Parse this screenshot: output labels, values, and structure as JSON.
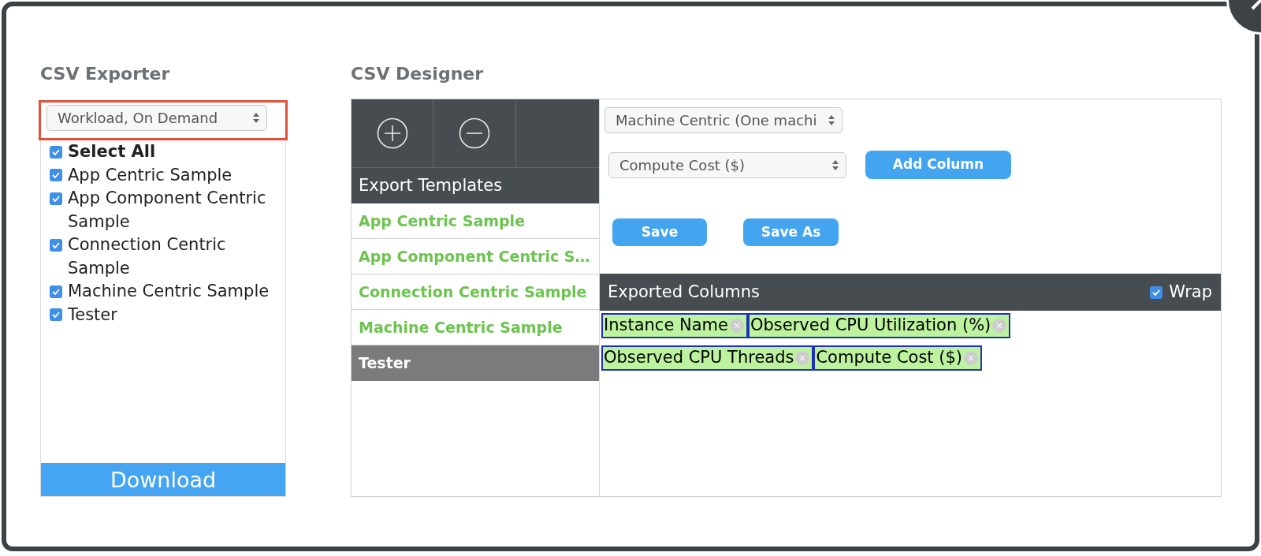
{
  "exporter": {
    "title": "CSV Exporter",
    "selector": {
      "value": "Workload, On Demand",
      "highlighted": true
    },
    "items": [
      {
        "label": "Select All",
        "kind": "all",
        "checked": true
      },
      {
        "label": "App Centric Sample",
        "kind": "template",
        "checked": true
      },
      {
        "label": "App Component Centric Sample",
        "kind": "template",
        "checked": true
      },
      {
        "label": "Connection Centric Sample",
        "kind": "template",
        "checked": true
      },
      {
        "label": "Machine Centric Sample",
        "kind": "template",
        "checked": true
      },
      {
        "label": "Tester",
        "kind": "template",
        "checked": true
      }
    ],
    "download": "Download"
  },
  "designer": {
    "title": "CSV Designer",
    "templates_header": "Export Templates",
    "templates": [
      {
        "label": "App Centric Sample",
        "selected": false
      },
      {
        "label": "App Component Centric S…",
        "selected": false
      },
      {
        "label": "Connection Centric Sample",
        "selected": false
      },
      {
        "label": "Machine Centric Sample",
        "selected": false
      },
      {
        "label": "Tester",
        "selected": true
      }
    ],
    "view_selector": {
      "value": "Machine Centric (One machi"
    },
    "column_selector": {
      "value": "Compute Cost ($)"
    },
    "add_column": "Add Column",
    "save": "Save",
    "save_as": "Save As",
    "exported_columns": {
      "title": "Exported Columns",
      "wrap": {
        "label": "Wrap",
        "checked": true
      },
      "columns": [
        {
          "label": "Instance Name"
        },
        {
          "label": "Observed CPU Utilization (%)"
        },
        {
          "label": "Observed CPU Threads"
        },
        {
          "label": "Compute Cost ($)"
        }
      ]
    }
  }
}
